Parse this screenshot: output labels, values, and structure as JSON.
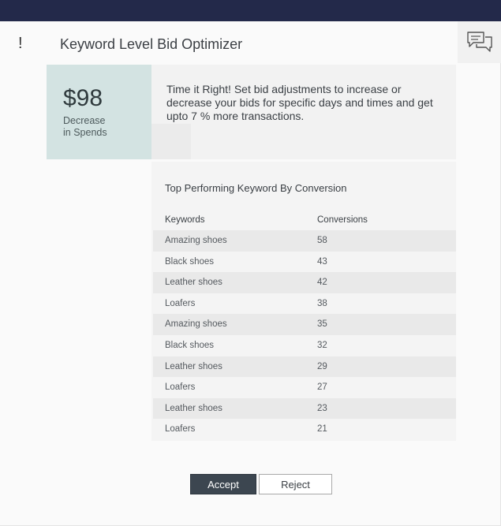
{
  "header": {
    "alert_symbol": "!",
    "title": "Keyword Level Bid Optimizer",
    "chat_icon": "chat-bubbles-icon"
  },
  "metric": {
    "value": "$98",
    "label_line1": "Decrease",
    "label_line2": "in Spends"
  },
  "message": "Time it Right! Set bid adjustments to increase or decrease your bids for specific days and times and get upto 7 % more transactions.",
  "table": {
    "title": "Top Performing Keyword By Conversion",
    "columns": [
      "Keywords",
      "Conversions"
    ],
    "rows": [
      {
        "keyword": "Amazing shoes",
        "conversions": "58"
      },
      {
        "keyword": "Black shoes",
        "conversions": "43"
      },
      {
        "keyword": "Leather shoes",
        "conversions": "42"
      },
      {
        "keyword": "Loafers",
        "conversions": "38"
      },
      {
        "keyword": "Amazing shoes",
        "conversions": "35"
      },
      {
        "keyword": "Black shoes",
        "conversions": "32"
      },
      {
        "keyword": "Leather shoes",
        "conversions": "29"
      },
      {
        "keyword": "Loafers",
        "conversions": "27"
      },
      {
        "keyword": "Leather shoes",
        "conversions": "23"
      },
      {
        "keyword": "Loafers",
        "conversions": "21"
      }
    ]
  },
  "actions": {
    "accept_label": "Accept",
    "reject_label": "Reject"
  },
  "colors": {
    "topbar": "#23294a",
    "metric_bg": "#d3e3e2",
    "accept_bg": "#3c4650"
  }
}
